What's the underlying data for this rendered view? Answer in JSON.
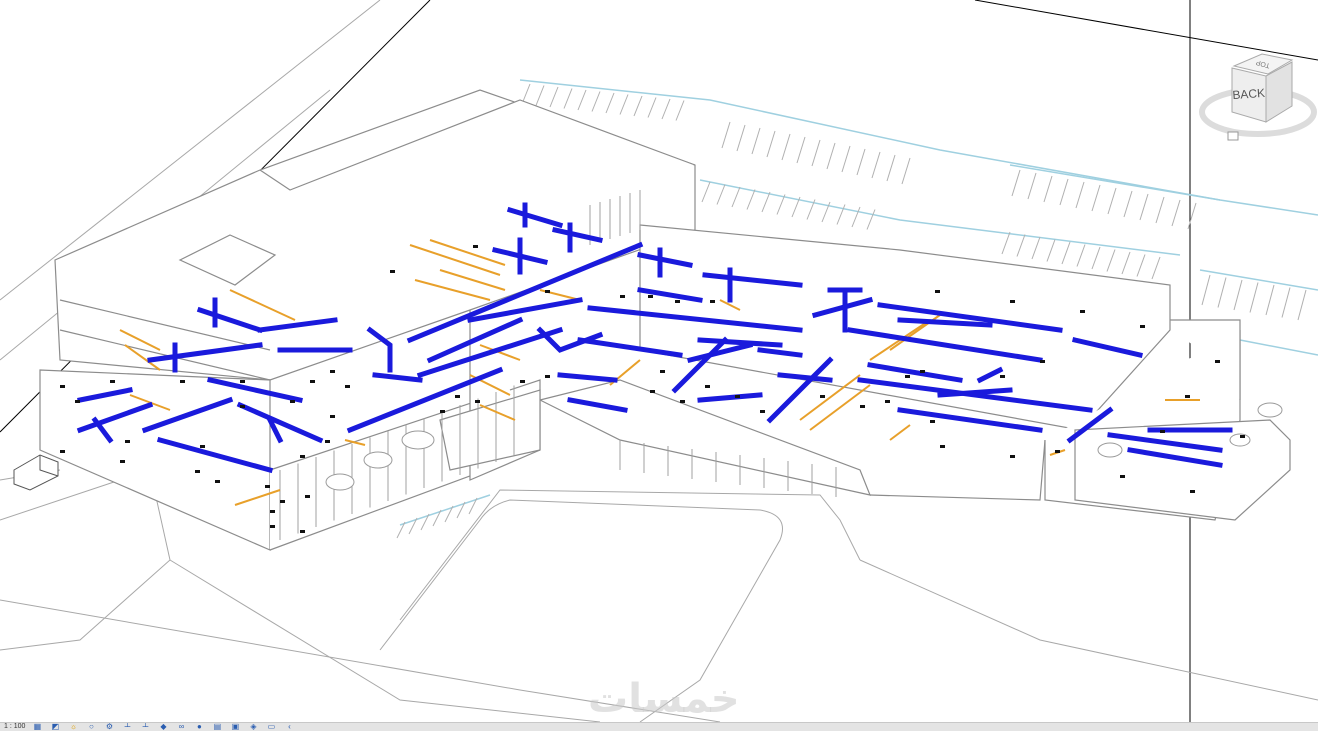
{
  "viewcube": {
    "face_label": "BACK",
    "top_label": "TOP",
    "face_color": "#eeeeee",
    "ring_color": "#dcdcdc"
  },
  "colors": {
    "duct": "#1a1adc",
    "duct_dark": "#0d0d9a",
    "pipe": "#e8a02a",
    "linework": "#8c8c8c",
    "parking": "#9fd0e0",
    "section_line": "#000000"
  },
  "statusbar": {
    "scale_text": "1 : 100",
    "icons": [
      "detail-level-icon",
      "visual-style-icon",
      "sun-path-icon",
      "shadows-icon",
      "render-icon",
      "crop-view-icon",
      "show-crop-icon",
      "unlock-3d-icon",
      "temporary-hide-icon",
      "reveal-hidden-icon",
      "analytical-model-icon",
      "highlight-displacement-icon",
      "reveal-constraints-icon",
      "worksharing-icon",
      "more-icon"
    ]
  },
  "watermark": "خمسات"
}
